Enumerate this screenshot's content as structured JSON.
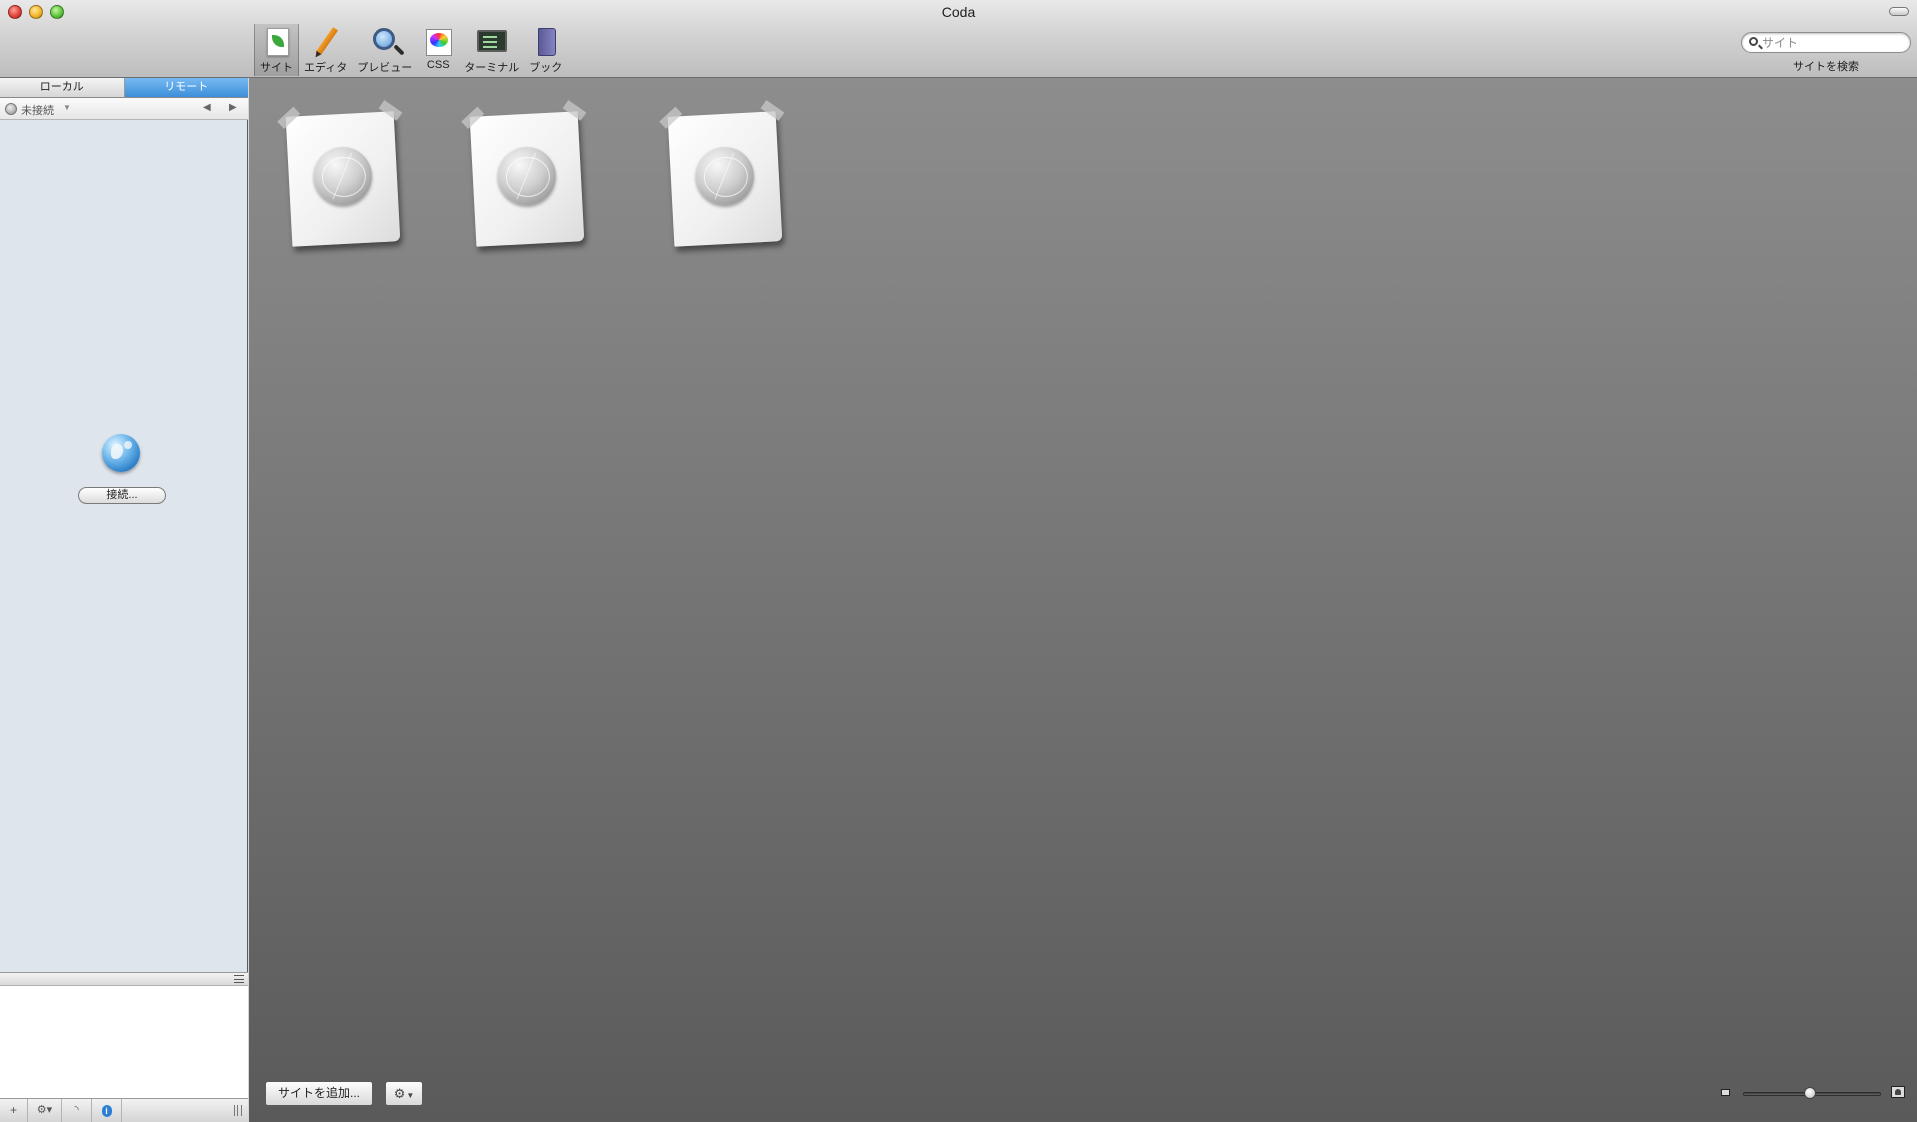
{
  "window": {
    "title": "Coda"
  },
  "toolbar": {
    "items": [
      {
        "label": "サイト",
        "icon": "site-icon",
        "selected": true
      },
      {
        "label": "エディタ",
        "icon": "editor-pencil-icon",
        "selected": false
      },
      {
        "label": "プレビュー",
        "icon": "preview-magnifier-icon",
        "selected": false
      },
      {
        "label": "CSS",
        "icon": "css-palette-icon",
        "selected": false
      },
      {
        "label": "ターミナル",
        "icon": "terminal-icon",
        "selected": false
      },
      {
        "label": "ブック",
        "icon": "book-icon",
        "selected": false
      }
    ],
    "search": {
      "placeholder": "サイト",
      "value": "",
      "label": "サイトを検索"
    }
  },
  "sidebar": {
    "tabs": [
      {
        "label": "ローカル",
        "active": false
      },
      {
        "label": "リモート",
        "active": true
      }
    ],
    "connection": {
      "status": "未接続"
    },
    "connect_button": "接続..."
  },
  "main": {
    "site_cards": [
      {
        "icon": "web-globe-icon"
      },
      {
        "icon": "web-globe-icon"
      },
      {
        "icon": "web-globe-icon"
      }
    ],
    "add_site_button": "サイトを追加..."
  },
  "colors": {
    "tab_active": "#4a9be3",
    "main_bg_top": "#8d8d8d",
    "main_bg_bottom": "#5a5a5a",
    "sidebar_bg": "#dfe5ec"
  }
}
